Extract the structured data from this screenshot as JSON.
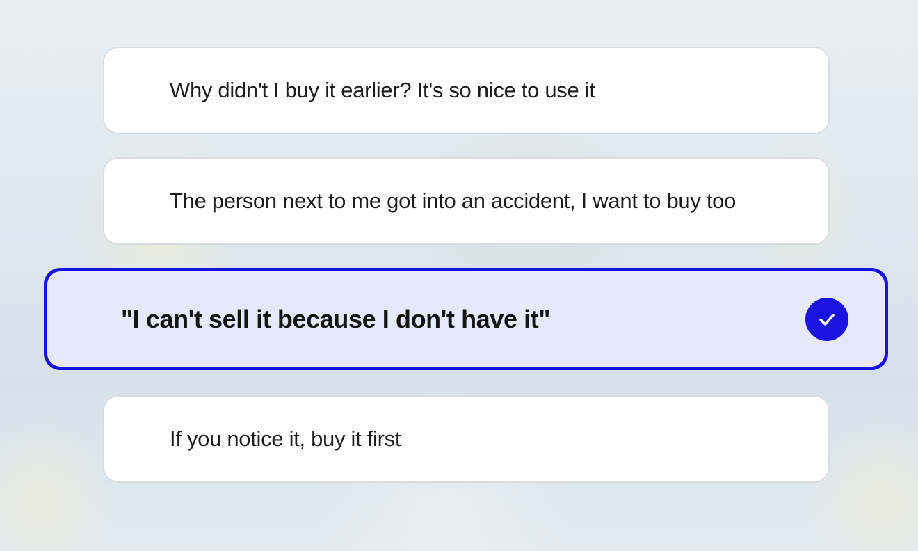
{
  "options": [
    {
      "label": "Why didn't I buy it earlier? It's so nice to use it",
      "selected": false
    },
    {
      "label": "The person next to me got into an accident, I want to buy too",
      "selected": false
    },
    {
      "label": "\"I can't sell it because I don't have it\"",
      "selected": true
    },
    {
      "label": "If you notice it, buy it first",
      "selected": false
    }
  ],
  "colors": {
    "accent": "#1a12e0",
    "selected_background": "#e8e8fb",
    "option_background": "#ffffff",
    "option_border": "#d9dcdf"
  },
  "icons": {
    "selected_indicator": "check-circle-icon"
  }
}
